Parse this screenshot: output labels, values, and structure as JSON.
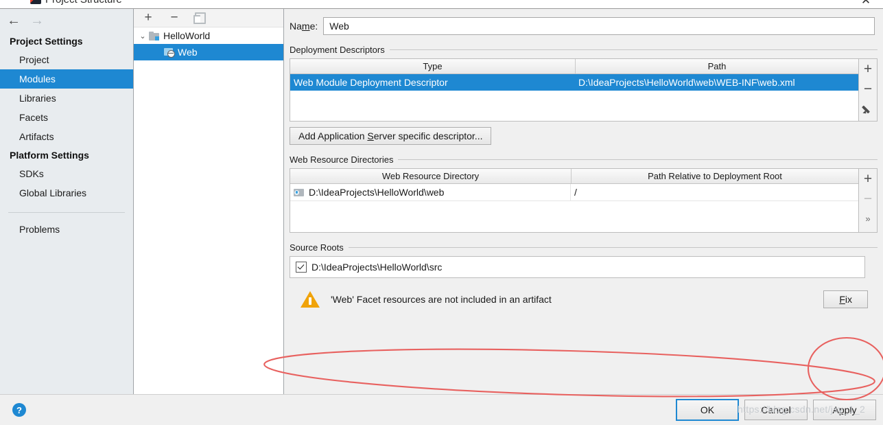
{
  "window": {
    "title": "Project Structure",
    "icon": "intellij-idea-icon",
    "close_label": "✕"
  },
  "sidebar": {
    "nav": {
      "back": "←",
      "forward": "→"
    },
    "groups": [
      {
        "label": "Project Settings",
        "items": [
          {
            "label": "Project",
            "selected": false
          },
          {
            "label": "Modules",
            "selected": true
          },
          {
            "label": "Libraries",
            "selected": false
          },
          {
            "label": "Facets",
            "selected": false
          },
          {
            "label": "Artifacts",
            "selected": false
          }
        ]
      },
      {
        "label": "Platform Settings",
        "items": [
          {
            "label": "SDKs",
            "selected": false
          },
          {
            "label": "Global Libraries",
            "selected": false
          }
        ]
      }
    ],
    "problems": {
      "label": "Problems"
    }
  },
  "tree": {
    "toolbar": {
      "add": "+",
      "remove": "−",
      "copy": "copy-icon"
    },
    "nodes": [
      {
        "label": "HelloWorld",
        "icon": "module-folder-icon",
        "chevron": "⌄",
        "selected": false,
        "depth": 0
      },
      {
        "label": "Web",
        "icon": "web-facet-icon",
        "chevron": "",
        "selected": true,
        "depth": 1
      }
    ]
  },
  "detail": {
    "name_label_before": "Na",
    "name_label_mnemonic": "m",
    "name_label_after": "e:",
    "name_value": "Web",
    "deployment": {
      "section_title": "Deployment Descriptors",
      "columns": [
        "Type",
        "Path"
      ],
      "rows": [
        {
          "type": "Web Module Deployment Descriptor",
          "path": "D:\\IdeaProjects\\HelloWorld\\web\\WEB-INF\\web.xml",
          "selected": true
        }
      ],
      "side_buttons": [
        "+",
        "−",
        "edit-pencil-icon"
      ],
      "add_button_before": "Add Application ",
      "add_button_mnemonic": "S",
      "add_button_after": "erver specific descriptor..."
    },
    "web_resources": {
      "section_title": "Web Resource Directories",
      "columns": [
        "Web Resource Directory",
        "Path Relative to Deployment Root"
      ],
      "rows": [
        {
          "directory": "D:\\IdeaProjects\\HelloWorld\\web",
          "relative_path": "/",
          "icon": "resource-dir-icon"
        }
      ],
      "side_buttons": [
        "+",
        "−",
        "»"
      ]
    },
    "source_roots": {
      "section_title": "Source Roots",
      "rows": [
        {
          "path": "D:\\IdeaProjects\\HelloWorld\\src",
          "checked": true
        }
      ]
    },
    "warning": {
      "icon": "warning-triangle-icon",
      "text": "'Web' Facet resources are not included in an artifact",
      "fix_mnemonic": "F",
      "fix_after": "ix"
    }
  },
  "footer": {
    "help": "?",
    "buttons": [
      {
        "label": "OK",
        "default": true
      },
      {
        "label": "Cancel",
        "default": false
      },
      {
        "label": "Apply",
        "default": false,
        "mnemonic_index": 1
      }
    ]
  },
  "watermark": "https://blog.csdn.net/jsy_1_2",
  "colors": {
    "selection_blue": "#1e88d2",
    "sidebar_bg": "#e8ecef",
    "panel_bg": "#f0f0f0",
    "warning_orange": "#f0a30a",
    "annotation_red": "#e8615f"
  }
}
